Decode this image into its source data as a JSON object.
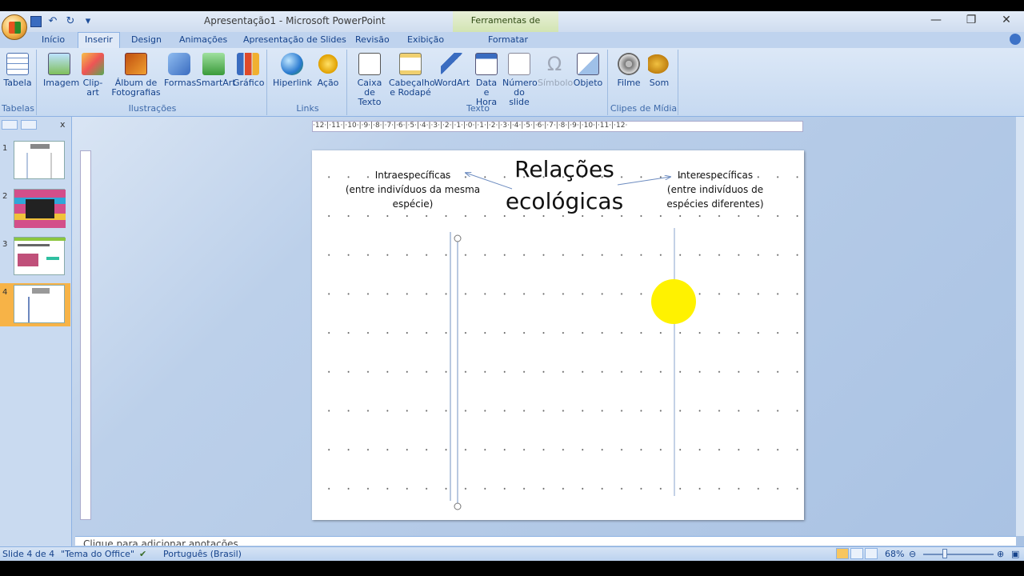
{
  "app": {
    "title": "Apresentação1 - Microsoft PowerPoint",
    "contextual_tab_group": "Ferramentas de Desenho",
    "window_controls": [
      "—",
      "❐",
      "✕"
    ]
  },
  "tabs": [
    {
      "label": "Início",
      "active": false
    },
    {
      "label": "Inserir",
      "active": true
    },
    {
      "label": "Design",
      "active": false
    },
    {
      "label": "Animações",
      "active": false
    },
    {
      "label": "Apresentação de Slides",
      "active": false
    },
    {
      "label": "Revisão",
      "active": false
    },
    {
      "label": "Exibição",
      "active": false
    },
    {
      "label": "Formatar",
      "active": false
    }
  ],
  "ribbon": {
    "groups": [
      "Tabelas",
      "Ilustrações",
      "Links",
      "Texto",
      "Clipes de Mídia"
    ],
    "buttons": {
      "tabela": "Tabela",
      "imagem": "Imagem",
      "clipart": "Clip-art",
      "album_1": "Álbum de",
      "album_2": "Fotografias",
      "formas": "Formas",
      "smartart": "SmartArt",
      "grafico": "Gráfico",
      "hiperlink": "Hiperlink",
      "acao": "Ação",
      "caixa_1": "Caixa de",
      "caixa_2": "Texto",
      "cabecalho_1": "Cabeçalho",
      "cabecalho_2": "e Rodapé",
      "wordart": "WordArt",
      "data_1": "Data e",
      "data_2": "Hora",
      "numero_1": "Número",
      "numero_2": "do slide",
      "simbolo": "Símbolo",
      "objeto": "Objeto",
      "filme": "Filme",
      "som": "Som"
    }
  },
  "slides_pane": {
    "numbers": [
      "1",
      "2",
      "3",
      "4"
    ],
    "selected": 4
  },
  "ruler": {
    "horizontal": "·12·|·11·|·10·|·9·|·8·|·7·|·6·|·5·|·4·|·3·|·2·|·1·|·0·|·1·|·2·|·3·|·4·|·5·|·6·|·7·|·8·|·9·|·10·|·11·|·12·"
  },
  "slide": {
    "title_line1": "Relações",
    "title_line2": "ecológicas",
    "left_text_1": "Intraespecíficas",
    "left_text_2": "(entre indivíduos  da mesma",
    "left_text_3": "espécie)",
    "right_text_1": "Interespecíficas",
    "right_text_2": "(entre indivíduos  de",
    "right_text_3": "espécies diferentes)",
    "circle_color": "#fff200"
  },
  "notes": {
    "placeholder": "Clique para adicionar anotações"
  },
  "status": {
    "slide_info": "Slide 4 de 4",
    "theme": "\"Tema do Office\"",
    "language": "Português (Brasil)",
    "zoom": "68%"
  }
}
